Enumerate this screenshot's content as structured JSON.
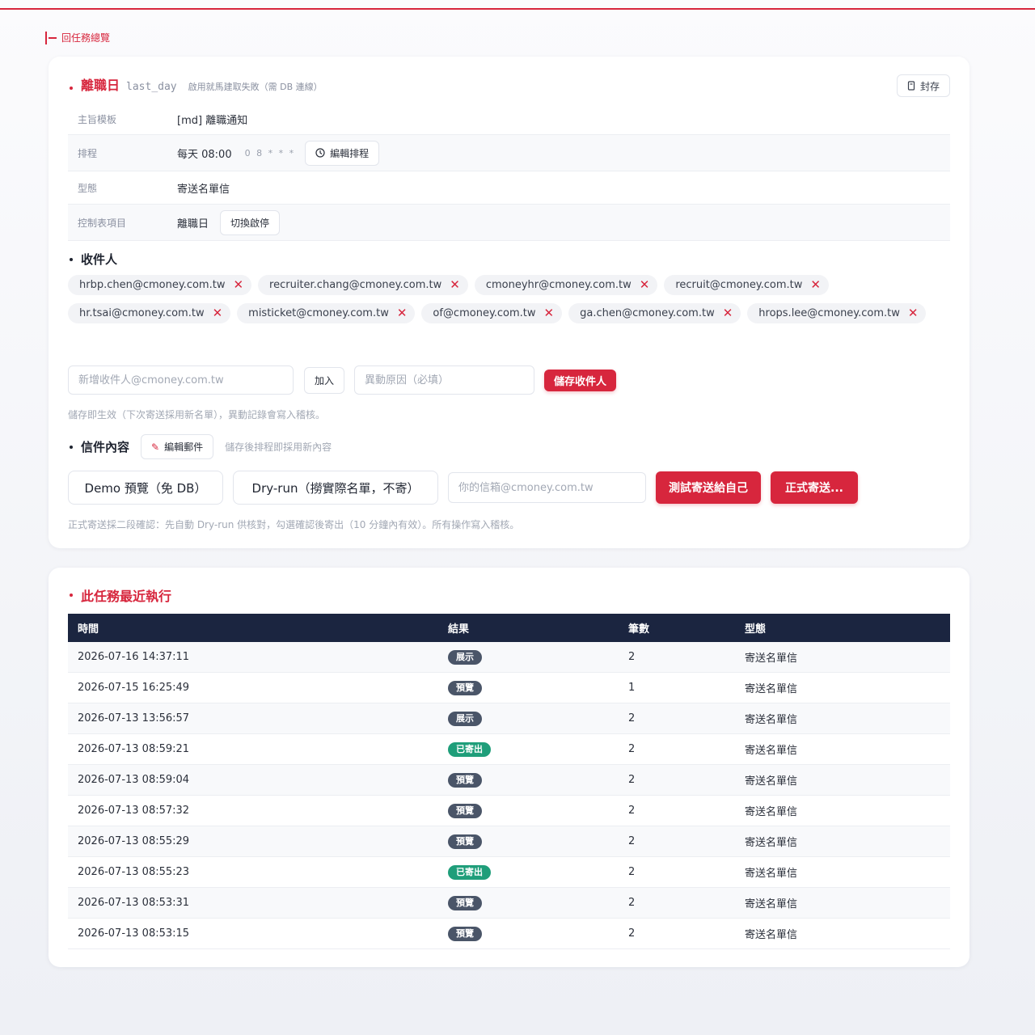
{
  "nav": {
    "back_label": "回任務總覽"
  },
  "task": {
    "title": "離職日",
    "code": "last_day",
    "desc": "啟用就馬建取失敗（需 DB 連線）",
    "archive_label": "封存",
    "meta": {
      "template_key": "主旨模板",
      "template_value": "[md] 離職通知",
      "schedule_key": "排程",
      "schedule_value": "每天 08:00",
      "schedule_cron": "0 8 * * *",
      "edit_schedule_label": "編輯排程",
      "form_key": "型態",
      "form_value": "寄送名單信",
      "control_key": "控制表項目",
      "control_value": "離職日",
      "toggle_label": "切換啟停"
    }
  },
  "recipients": {
    "heading": "收件人",
    "chips": [
      "hrbp.chen@cmoney.com.tw",
      "recruiter.chang@cmoney.com.tw",
      "cmoneyhr@cmoney.com.tw",
      "recruit@cmoney.com.tw",
      "hr.tsai@cmoney.com.tw",
      "misticket@cmoney.com.tw",
      "of@cmoney.com.tw",
      "ga.chen@cmoney.com.tw",
      "hrops.lee@cmoney.com.tw"
    ],
    "remove_glyph": "✕",
    "new_placeholder": "新增收件人@cmoney.com.tw",
    "add_label": "加入",
    "reason_placeholder": "異動原因（必填）",
    "save_label": "儲存收件人",
    "hint": "儲存即生效（下次寄送採用新名單），異動記錄會寫入稽核。"
  },
  "content": {
    "heading": "信件內容",
    "edit_label": "編輯郵件",
    "hint": "儲存後排程即採用新內容"
  },
  "send": {
    "demo_label": "Demo 預覽（免 DB）",
    "dryrun_label": "Dry-run（撈實際名單，不寄）",
    "email_placeholder": "你的信箱@cmoney.com.tw",
    "test_label": "測試寄送給自己",
    "real_label": "正式寄送...",
    "hint": "正式寄送採二段確認：先自動 Dry-run 供核對，勾選確認後寄出（10 分鐘內有效）。所有操作寫入稽核。"
  },
  "runs": {
    "heading": "此任務最近執行",
    "columns": [
      "時間",
      "結果",
      "筆數",
      "型態"
    ],
    "rows": [
      {
        "time": "2026-07-16 14:37:11",
        "result": "展示",
        "count": "2",
        "type": "寄送名單信"
      },
      {
        "time": "2026-07-15 16:25:49",
        "result": "預覽",
        "count": "1",
        "type": "寄送名單信"
      },
      {
        "time": "2026-07-13 13:56:57",
        "result": "展示",
        "count": "2",
        "type": "寄送名單信"
      },
      {
        "time": "2026-07-13 08:59:21",
        "result": "已寄出",
        "count": "2",
        "type": "寄送名單信"
      },
      {
        "time": "2026-07-13 08:59:04",
        "result": "預覽",
        "count": "2",
        "type": "寄送名單信"
      },
      {
        "time": "2026-07-13 08:57:32",
        "result": "預覽",
        "count": "2",
        "type": "寄送名單信"
      },
      {
        "time": "2026-07-13 08:55:29",
        "result": "預覽",
        "count": "2",
        "type": "寄送名單信"
      },
      {
        "time": "2026-07-13 08:55:23",
        "result": "已寄出",
        "count": "2",
        "type": "寄送名單信"
      },
      {
        "time": "2026-07-13 08:53:31",
        "result": "預覽",
        "count": "2",
        "type": "寄送名單信"
      },
      {
        "time": "2026-07-13 08:53:15",
        "result": "預覽",
        "count": "2",
        "type": "寄送名單信"
      }
    ]
  },
  "colors": {
    "accent": "#d7263d",
    "table_header": "#1b2540",
    "badge_neutral": "#4a5568",
    "badge_success": "#1f9e7a"
  }
}
